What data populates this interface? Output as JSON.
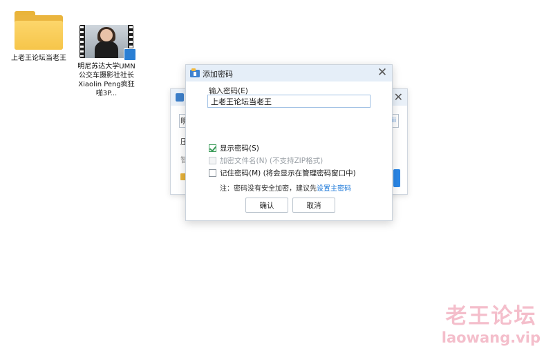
{
  "desktop": {
    "folder_label": "上老王论坛当老王",
    "video_label": "明尼苏达大学UMN公交车摄影社社长Xiaolin Peng疯狂啪3P..."
  },
  "background_dialog": {
    "fragments": [
      "明",
      "压",
      "智"
    ]
  },
  "dialog": {
    "title": "添加密码",
    "password_label": "输入密码(E)",
    "password_value": "上老王论坛当老王",
    "show_password": {
      "label": "显示密码(S)",
      "checked": true
    },
    "encrypt_filename": {
      "label": "加密文件名(N) (不支持ZIP格式)",
      "checked": false,
      "disabled": true
    },
    "remember_password": {
      "label": "记住密码(M) (将会显示在管理密码窗口中)",
      "checked": false
    },
    "note_prefix": "注：密码没有安全加密，建议先",
    "note_link": "设置主密码",
    "ok_label": "确认",
    "cancel_label": "取消"
  },
  "watermark": {
    "cn": "老王论坛",
    "url": "laowang.vip"
  },
  "colors": {
    "titlebar": "#e5eef8",
    "link": "#1f7ad9",
    "check_green": "#3c9c5a",
    "watermark": "#f3b8c6"
  }
}
